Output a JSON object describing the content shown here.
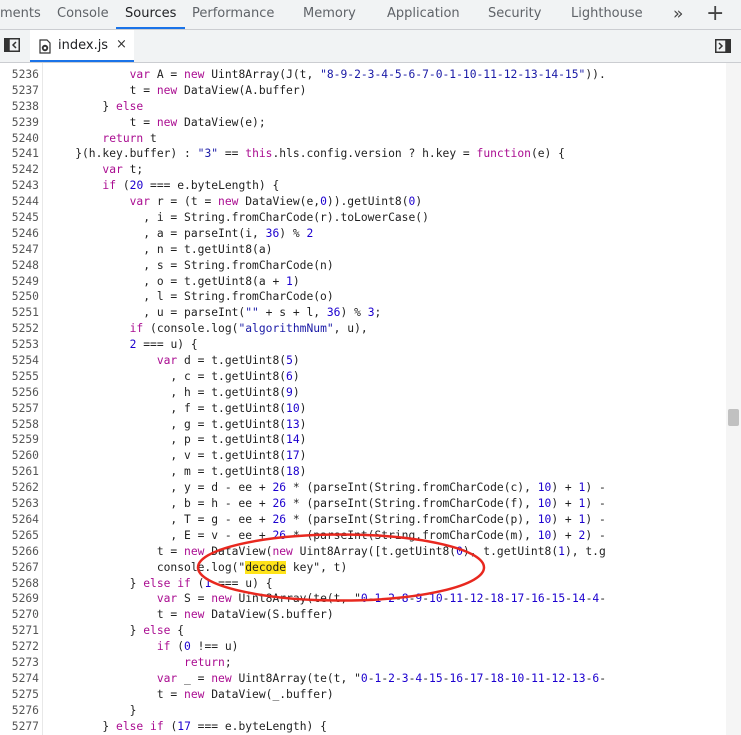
{
  "tabs": [
    "ments",
    "Console",
    "Sources",
    "Performance",
    "Memory",
    "Application",
    "Security",
    "Lighthouse"
  ],
  "active_tab": "Sources",
  "more_tabs_icon": "»",
  "add_tab_icon": "+",
  "file_tab": {
    "name": "index.js",
    "close": "×"
  },
  "lines": [
    {
      "n": "5236",
      "t": "            var A = new Uint8Array(J(t, \"8-9-2-3-4-5-6-7-0-1-10-11-12-13-14-15\"))."
    },
    {
      "n": "5237",
      "t": "            t = new DataView(A.buffer)"
    },
    {
      "n": "5238",
      "t": "        } else"
    },
    {
      "n": "5239",
      "t": "            t = new DataView(e);"
    },
    {
      "n": "5240",
      "t": "        return t"
    },
    {
      "n": "5241",
      "t": "    }(h.key.buffer) : \"3\" == this.hls.config.version ? h.key = function(e) {"
    },
    {
      "n": "5242",
      "t": "        var t;"
    },
    {
      "n": "5243",
      "t": "        if (20 === e.byteLength) {"
    },
    {
      "n": "5244",
      "t": "            var r = (t = new DataView(e,0)).getUint8(0)"
    },
    {
      "n": "5245",
      "t": "              , i = String.fromCharCode(r).toLowerCase()"
    },
    {
      "n": "5246",
      "t": "              , a = parseInt(i, 36) % 2"
    },
    {
      "n": "5247",
      "t": "              , n = t.getUint8(a)"
    },
    {
      "n": "5248",
      "t": "              , s = String.fromCharCode(n)"
    },
    {
      "n": "5249",
      "t": "              , o = t.getUint8(a + 1)"
    },
    {
      "n": "5250",
      "t": "              , l = String.fromCharCode(o)"
    },
    {
      "n": "5251",
      "t": "              , u = parseInt(\"\" + s + l, 36) % 3;"
    },
    {
      "n": "5252",
      "t": "            if (console.log(\"algorithmNum\", u),"
    },
    {
      "n": "5253",
      "t": "            2 === u) {"
    },
    {
      "n": "5254",
      "t": "                var d = t.getUint8(5)"
    },
    {
      "n": "5255",
      "t": "                  , c = t.getUint8(6)"
    },
    {
      "n": "5256",
      "t": "                  , h = t.getUint8(9)"
    },
    {
      "n": "5257",
      "t": "                  , f = t.getUint8(10)"
    },
    {
      "n": "5258",
      "t": "                  , g = t.getUint8(13)"
    },
    {
      "n": "5259",
      "t": "                  , p = t.getUint8(14)"
    },
    {
      "n": "5260",
      "t": "                  , v = t.getUint8(17)"
    },
    {
      "n": "5261",
      "t": "                  , m = t.getUint8(18)"
    },
    {
      "n": "5262",
      "t": "                  , y = d - ee + 26 * (parseInt(String.fromCharCode(c), 10) + 1) -"
    },
    {
      "n": "5263",
      "t": "                  , b = h - ee + 26 * (parseInt(String.fromCharCode(f), 10) + 1) -"
    },
    {
      "n": "5264",
      "t": "                  , T = g - ee + 26 * (parseInt(String.fromCharCode(p), 10) + 1) -"
    },
    {
      "n": "5265",
      "t": "                  , E = v - ee + 26 * (parseInt(String.fromCharCode(m), 10) + 2) -"
    },
    {
      "n": "5266",
      "t": "                t = new DataView(new Uint8Array([t.getUint8(0), t.getUint8(1), t.g"
    },
    {
      "n": "5267",
      "pre": "                console.log(\"",
      "hl": "decode",
      "post": " key\", t)"
    },
    {
      "n": "5268",
      "t": "            } else if (1 === u) {"
    },
    {
      "n": "5269",
      "t": "                var S = new Uint8Array(te(t, \"0-1-2-8-9-10-11-12-18-17-16-15-14-4-"
    },
    {
      "n": "5270",
      "t": "                t = new DataView(S.buffer)"
    },
    {
      "n": "5271",
      "t": "            } else {"
    },
    {
      "n": "5272",
      "t": "                if (0 !== u)"
    },
    {
      "n": "5273",
      "t": "                    return;"
    },
    {
      "n": "5274",
      "t": "                var _ = new Uint8Array(te(t, \"0-1-2-3-4-15-16-17-18-10-11-12-13-6-"
    },
    {
      "n": "5275",
      "t": "                t = new DataView(_.buffer)"
    },
    {
      "n": "5276",
      "t": "            }"
    },
    {
      "n": "5277",
      "t": "        } else if (17 === e.byteLength) {"
    }
  ],
  "colors": {
    "keyword": "#aa0d91",
    "string": "#1a1aa6",
    "number": "#1c00cf",
    "highlight": "#ffe41a",
    "annotation": "#e8281f",
    "accent": "#1a73e8"
  }
}
